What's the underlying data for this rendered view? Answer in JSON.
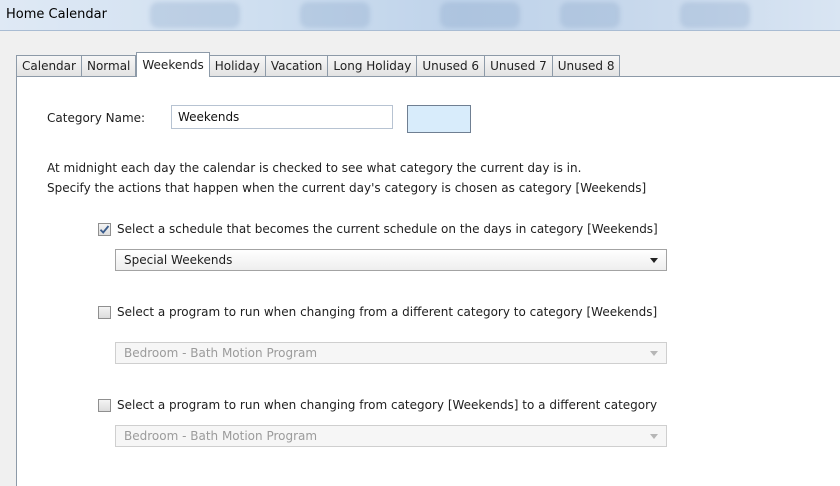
{
  "window": {
    "title": "Home Calendar"
  },
  "tabs": [
    {
      "label": "Calendar",
      "active": false
    },
    {
      "label": "Normal",
      "active": false
    },
    {
      "label": "Weekends",
      "active": true
    },
    {
      "label": "Holiday",
      "active": false
    },
    {
      "label": "Vacation",
      "active": false
    },
    {
      "label": "Long Holiday",
      "active": false
    },
    {
      "label": "Unused 6",
      "active": false
    },
    {
      "label": "Unused 7",
      "active": false
    },
    {
      "label": "Unused 8",
      "active": false
    }
  ],
  "category": {
    "name_label": "Category Name:",
    "name_value": "Weekends",
    "color": "#d8ecfb"
  },
  "description": {
    "line1": "At midnight each day the calendar is checked to see what category the current day is in.",
    "line2": "Specify the actions that happen when the current day's category is chosen as category [Weekends]"
  },
  "options": [
    {
      "label": "Select a schedule that becomes the current schedule on the days in category [Weekends]",
      "checked": true,
      "selected": "Special Weekends",
      "enabled": true
    },
    {
      "label": "Select a program to run when changing from a different category to category [Weekends]",
      "checked": false,
      "selected": "Bedroom - Bath Motion Program",
      "enabled": false
    },
    {
      "label": "Select a program to run when changing from category [Weekends] to a different category",
      "checked": false,
      "selected": "Bedroom - Bath Motion Program",
      "enabled": false
    }
  ],
  "icons": {
    "checkbox_check": "checkmark-icon",
    "dropdown_arrow": "chevron-down-icon"
  }
}
